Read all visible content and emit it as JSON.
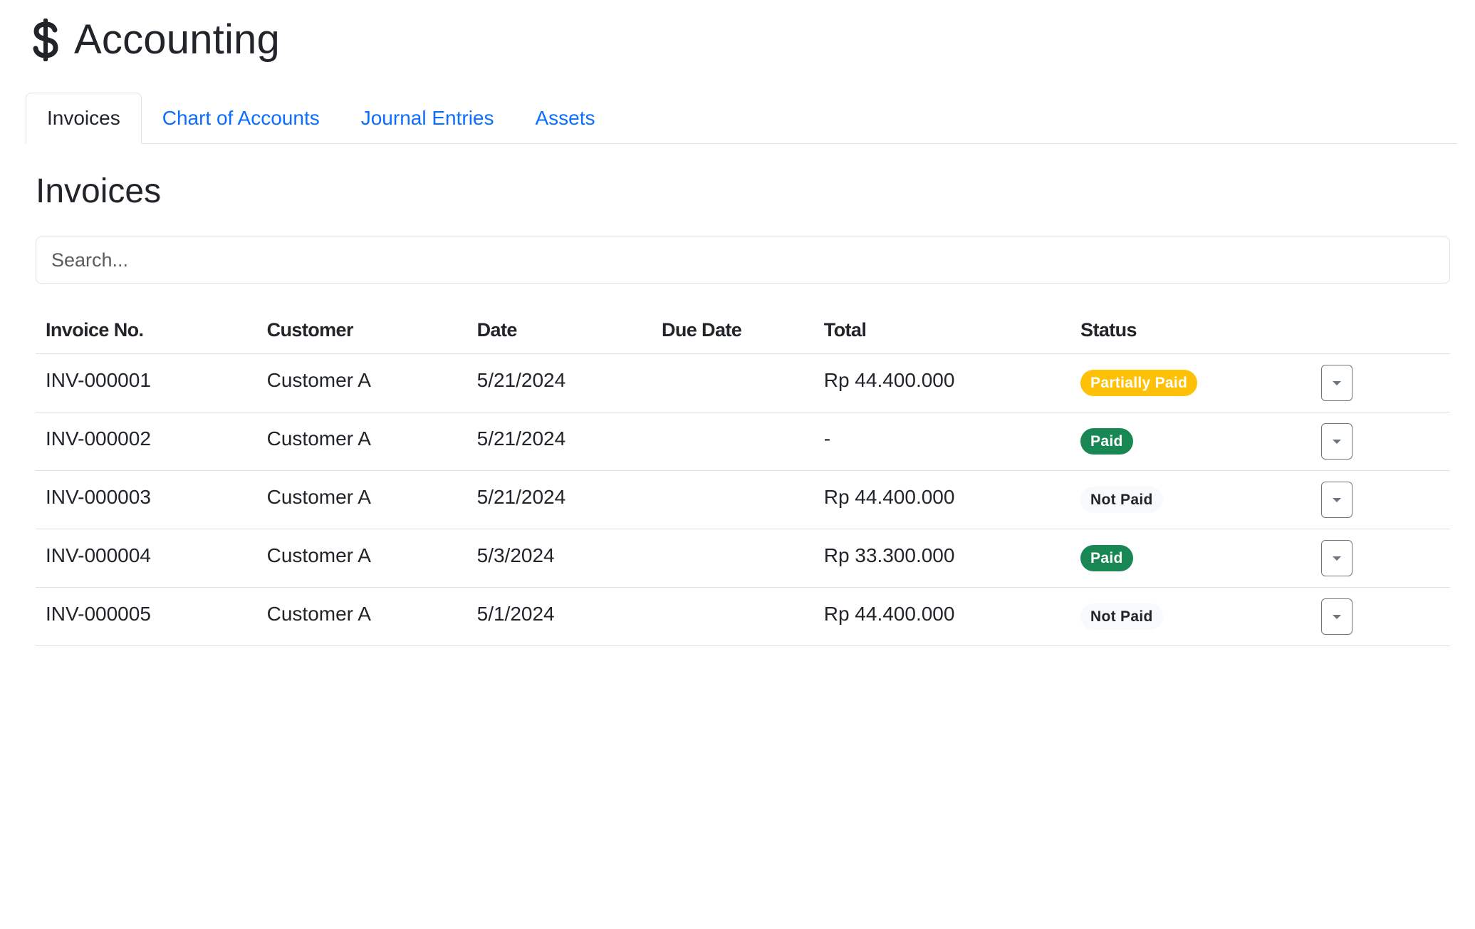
{
  "app": {
    "title": "Accounting",
    "icon": "dollar-icon"
  },
  "tabs": [
    {
      "label": "Invoices",
      "active": true
    },
    {
      "label": "Chart of Accounts",
      "active": false
    },
    {
      "label": "Journal Entries",
      "active": false
    },
    {
      "label": "Assets",
      "active": false
    }
  ],
  "section": {
    "title": "Invoices"
  },
  "search": {
    "placeholder": "Search...",
    "value": ""
  },
  "table": {
    "columns": [
      "Invoice No.",
      "Customer",
      "Date",
      "Due Date",
      "Total",
      "Status",
      ""
    ],
    "rows": [
      {
        "invoice_no": "INV-000001",
        "customer": "Customer A",
        "date": "5/21/2024",
        "due_date": "",
        "total": "Rp 44.400.000",
        "status": "Partially Paid",
        "status_type": "partial"
      },
      {
        "invoice_no": "INV-000002",
        "customer": "Customer A",
        "date": "5/21/2024",
        "due_date": "",
        "total": "-",
        "status": "Paid",
        "status_type": "paid"
      },
      {
        "invoice_no": "INV-000003",
        "customer": "Customer A",
        "date": "5/21/2024",
        "due_date": "",
        "total": "Rp 44.400.000",
        "status": "Not Paid",
        "status_type": "notpaid"
      },
      {
        "invoice_no": "INV-000004",
        "customer": "Customer A",
        "date": "5/3/2024",
        "due_date": "",
        "total": "Rp 33.300.000",
        "status": "Paid",
        "status_type": "paid"
      },
      {
        "invoice_no": "INV-000005",
        "customer": "Customer A",
        "date": "5/1/2024",
        "due_date": "",
        "total": "Rp 44.400.000",
        "status": "Not Paid",
        "status_type": "notpaid"
      }
    ]
  },
  "colors": {
    "link": "#0d6efd",
    "partial": "#ffc107",
    "paid": "#198754",
    "not_paid_bg": "#f8f9fa",
    "text": "#212529",
    "border": "#dee2e6"
  }
}
